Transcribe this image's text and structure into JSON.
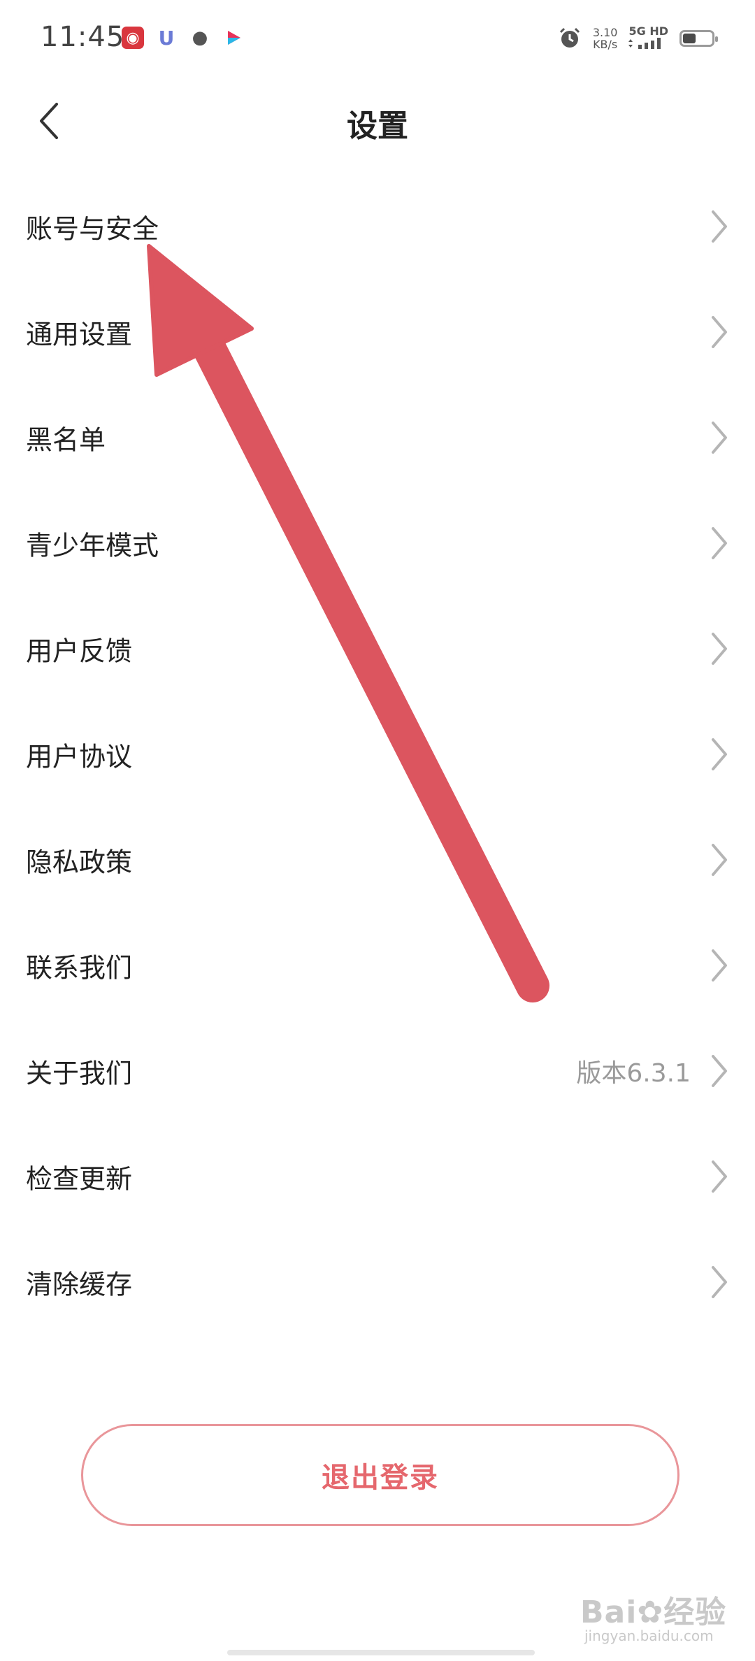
{
  "status_bar": {
    "time": "11:45",
    "net_speed_value": "3.10",
    "net_speed_unit": "KB/s",
    "network_type": "5G HD",
    "battery_level": 0.45,
    "notification_icons": [
      "app-red-icon",
      "magnet-icon",
      "wechat-icon",
      "video-app-icon"
    ]
  },
  "nav": {
    "title": "设置",
    "back_icon": "chevron-left-icon"
  },
  "settings": {
    "items": [
      {
        "label": "账号与安全",
        "value": ""
      },
      {
        "label": "通用设置",
        "value": ""
      },
      {
        "label": "黑名单",
        "value": ""
      },
      {
        "label": "青少年模式",
        "value": ""
      },
      {
        "label": "用户反馈",
        "value": ""
      },
      {
        "label": "用户协议",
        "value": ""
      },
      {
        "label": "隐私政策",
        "value": ""
      },
      {
        "label": "联系我们",
        "value": ""
      },
      {
        "label": "关于我们",
        "value": "版本6.3.1"
      },
      {
        "label": "检查更新",
        "value": ""
      },
      {
        "label": "清除缓存",
        "value": ""
      }
    ]
  },
  "logout": {
    "label": "退出登录"
  },
  "watermark": {
    "brand": "Bai",
    "brand_suffix": "经验",
    "domain": "jingyan.baidu.com"
  },
  "colors": {
    "accent": "#e5676d",
    "arrow": "#dc555f",
    "chevron": "#b5b5b5"
  }
}
